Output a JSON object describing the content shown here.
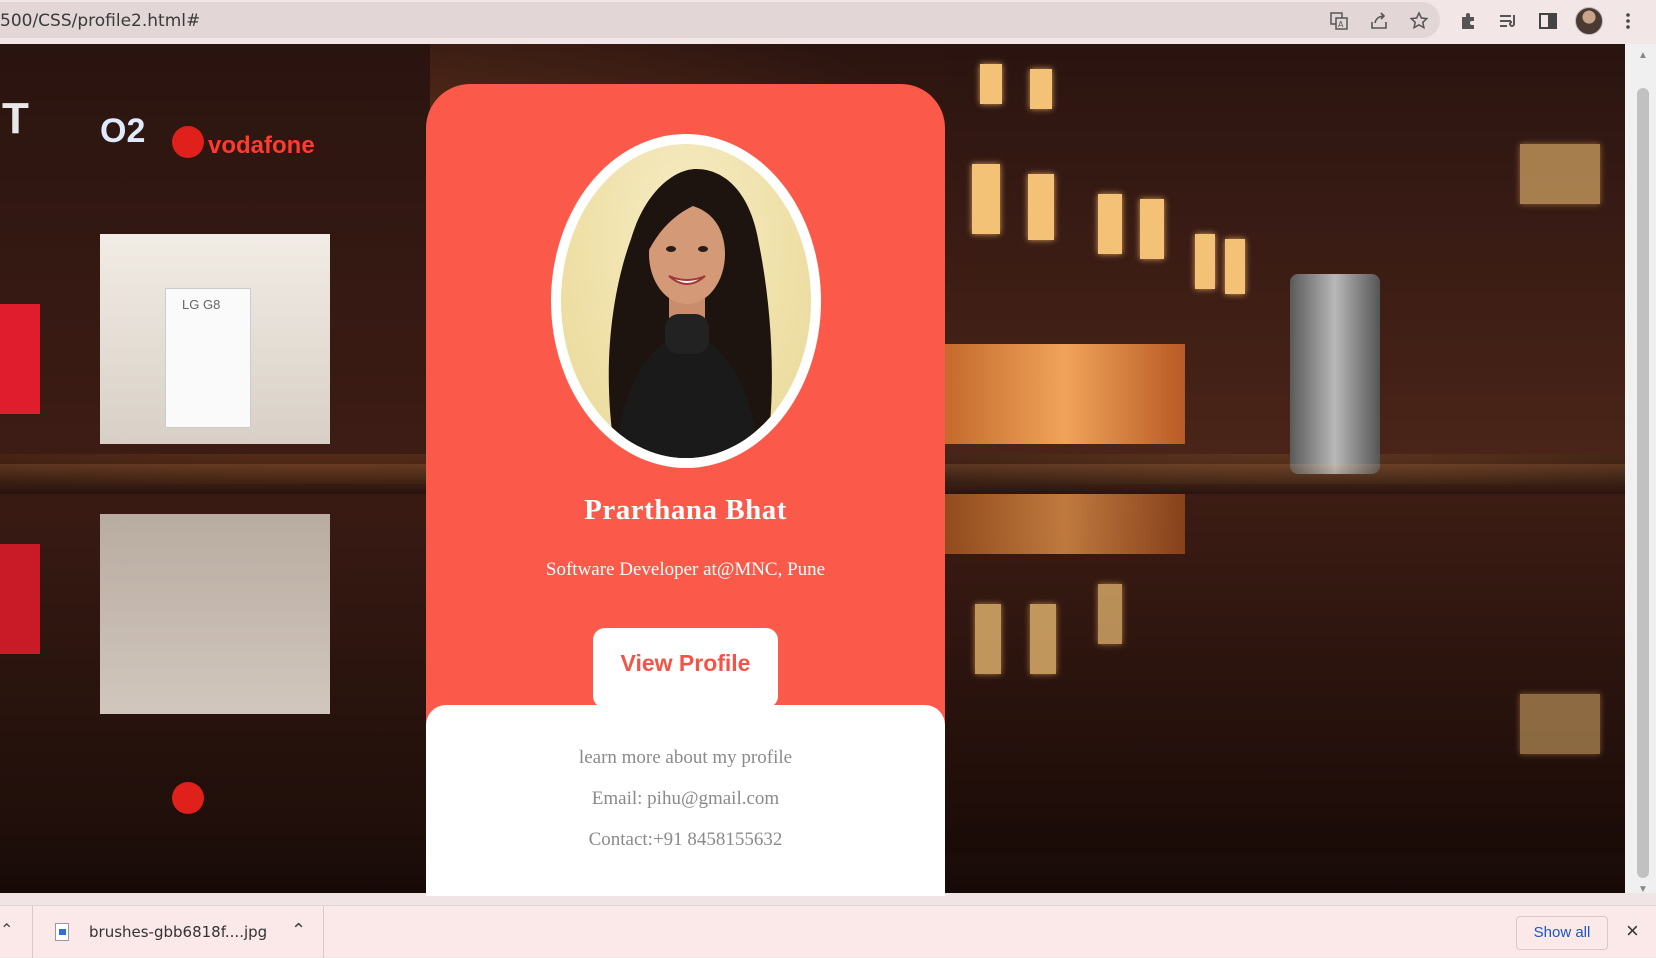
{
  "browser": {
    "url": "500/CSS/profile2.html#",
    "icons": [
      "translate-icon",
      "share-icon",
      "star-icon",
      "extensions-icon",
      "reading-list-icon",
      "side-panel-icon",
      "profile-avatar",
      "more-icon"
    ]
  },
  "background": {
    "brands": [
      "vodafone",
      "O2",
      "T",
      "LG G8"
    ]
  },
  "profile": {
    "name": "Prarthana Bhat",
    "role": "Software Developer at@MNC, Pune",
    "button_label": "View Profile",
    "about": "learn more about my profile",
    "email": "Email: pihu@gmail.com",
    "contact": "Contact:+91 8458155632"
  },
  "downloads": {
    "file_name": "brushes-gbb6818f....jpg",
    "show_all": "Show all"
  },
  "colors": {
    "card": "#fb594a",
    "button_text": "#f45447",
    "info_text": "#8a8a8a",
    "link": "#1a56c4"
  }
}
